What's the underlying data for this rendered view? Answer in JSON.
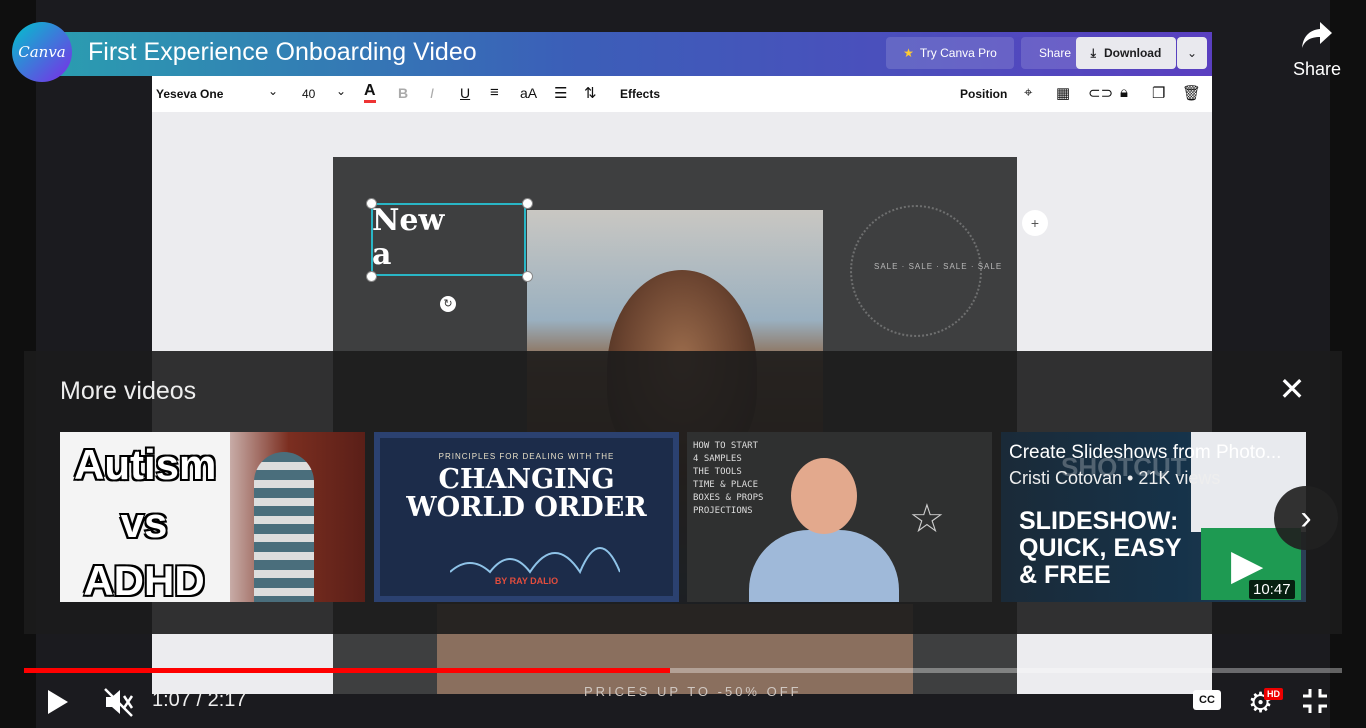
{
  "video": {
    "title": "First Experience Onboarding Video",
    "channel_logo_text": "Canva",
    "share_label": "Share",
    "current_time": "1:07",
    "duration": "2:17",
    "time_separator": " / ",
    "progress": 0.49,
    "hd_badge": "HD",
    "cc_label": "CC"
  },
  "canva": {
    "try_pro": "Try Canva Pro",
    "share": "Share",
    "download": "Download",
    "font_name": "Yeseva One",
    "font_size": "40",
    "effects": "Effects",
    "position": "Position",
    "textbox_line1": "New",
    "textbox_line2": "a",
    "sale_text": "SALE · SALE · SALE · SALE",
    "prices_text": "PRICES UP TO -50% OFF"
  },
  "more_videos": {
    "title": "More videos",
    "items": [
      {
        "thumb_line1": "Autism",
        "thumb_line2": "vs",
        "thumb_line3": "ADHD"
      },
      {
        "thumb_top": "PRINCIPLES FOR DEALING WITH THE",
        "thumb_line1": "CHANGING",
        "thumb_line2": "WORLD ORDER",
        "thumb_by": "BY RAY DALIO"
      },
      {
        "board_lines": [
          "HOW TO START",
          "4 SAMPLES",
          "THE TOOLS",
          "TIME & PLACE",
          "BOXES & PROPS",
          "PROJECTIONS"
        ]
      },
      {
        "title": "Create Slideshows from Photo...",
        "meta": "Cristi Cotovan • 21K views",
        "thumb_line1": "SLIDESHOW:",
        "thumb_line2": "QUICK, EASY",
        "thumb_line3": "& FREE",
        "duration": "10:47",
        "brand": "SHOTCUT"
      }
    ]
  }
}
